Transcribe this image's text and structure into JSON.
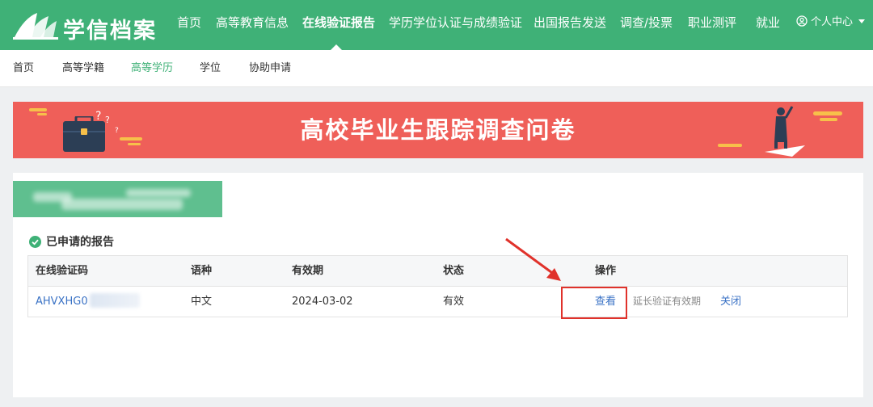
{
  "brand": {
    "name": "学信档案",
    "color": "#3fb177"
  },
  "nav": {
    "items": [
      {
        "label": "首页",
        "active": false
      },
      {
        "label": "高等教育信息",
        "active": false
      },
      {
        "label": "在线验证报告",
        "active": true
      },
      {
        "label": "学历学位认证与成绩验证",
        "active": false
      },
      {
        "label": "出国报告发送",
        "active": false
      },
      {
        "label": "调查/投票",
        "active": false
      },
      {
        "label": "职业测评",
        "active": false
      },
      {
        "label": "就业",
        "active": false
      }
    ],
    "user_menu": {
      "label": "个人中心",
      "icon": "user-circle-icon"
    }
  },
  "subnav": {
    "items": [
      {
        "label": "首页",
        "active": false
      },
      {
        "label": "高等学籍",
        "active": false
      },
      {
        "label": "高等学历",
        "active": true
      },
      {
        "label": "学位",
        "active": false
      },
      {
        "label": "协助申请",
        "active": false
      }
    ]
  },
  "banner": {
    "title": "高校毕业生跟踪调查问卷",
    "color": "#ef5f59"
  },
  "reports": {
    "section_title": "已申请的报告",
    "columns": [
      "在线验证码",
      "语种",
      "有效期",
      "状态",
      "操作"
    ],
    "rows": [
      {
        "code": "AHVXHG0",
        "language": "中文",
        "valid_until": "2024-03-02",
        "status": "有效",
        "actions": {
          "view": "查看",
          "extend": "延长验证有效期",
          "close": "关闭"
        }
      }
    ]
  },
  "colors": {
    "link": "#3a72c5",
    "highlight": "#e0322b"
  }
}
